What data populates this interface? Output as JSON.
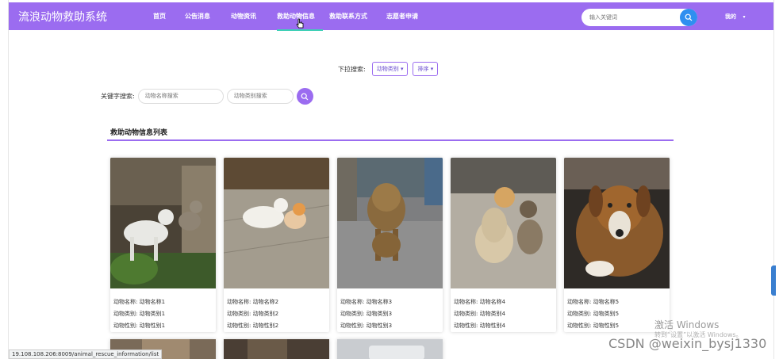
{
  "brand": "流浪动物救助系统",
  "nav": [
    "首页",
    "公告消息",
    "动物资讯",
    "救助动物信息",
    "救助联系方式",
    "志愿者申请"
  ],
  "search": {
    "placeholder": "输入关键词"
  },
  "user": "我的",
  "filters": {
    "dropdown_label": "下拉搜索:",
    "type_button": "动物类别",
    "sort_button": "排序",
    "keyword_label": "关键字搜索:",
    "name_placeholder": "动物名称搜索",
    "category_placeholder": "动物类别搜索"
  },
  "section": {
    "title": "救助动物信息列表"
  },
  "cards": [
    {
      "name_line": "动物名称: 动物名称1",
      "type_line": "动物类别: 动物类别1",
      "sex_line": "动物性别: 动物性别1"
    },
    {
      "name_line": "动物名称: 动物名称2",
      "type_line": "动物类别: 动物类别2",
      "sex_line": "动物性别: 动物性别2"
    },
    {
      "name_line": "动物名称: 动物名称3",
      "type_line": "动物类别: 动物类别3",
      "sex_line": "动物性别: 动物性别3"
    },
    {
      "name_line": "动物名称: 动物名称4",
      "type_line": "动物类别: 动物类别4",
      "sex_line": "动物性别: 动物性别4"
    },
    {
      "name_line": "动物名称: 动物名称5",
      "type_line": "动物类别: 动物类别5",
      "sex_line": "动物性别: 动物性别5"
    }
  ],
  "status_url": "19.108.108.206:8009/animal_rescue_information/list",
  "watermark": {
    "line1": "激活 Windows",
    "line2": "转到“设置”以激活 Windows。"
  },
  "csdn": "CSDN @weixin_bysj1330",
  "colors": {
    "accent": "#9b6cf0",
    "search_button": "#2f8ff0",
    "active_underline": "#3fd0b6"
  }
}
